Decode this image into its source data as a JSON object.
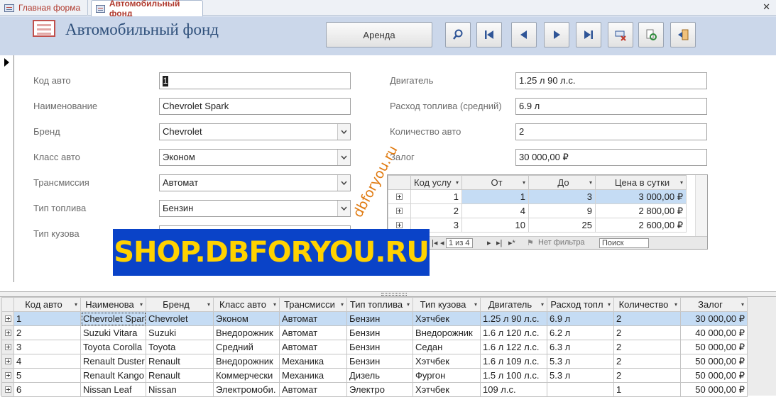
{
  "tabs": [
    {
      "label": "Главная форма"
    },
    {
      "label": "Автомобильный фонд"
    }
  ],
  "header": {
    "title": "Автомобильный фонд",
    "rent_label": "Аренда"
  },
  "form": {
    "left": [
      {
        "label": "Код авто",
        "value": "1"
      },
      {
        "label": "Наименование",
        "value": "Chevrolet Spark"
      },
      {
        "label": "Бренд",
        "value": "Chevrolet"
      },
      {
        "label": "Класс авто",
        "value": "Эконом"
      },
      {
        "label": "Трансмиссия",
        "value": "Автомат"
      },
      {
        "label": "Тип топлива",
        "value": "Бензин"
      },
      {
        "label": "Тип кузова",
        "value": ""
      }
    ],
    "right": [
      {
        "label": "Двигатель",
        "value": "1.25 л 90 л.с."
      },
      {
        "label": "Расход топлива (средний)",
        "value": "6.9 л"
      },
      {
        "label": "Количество авто",
        "value": "2"
      },
      {
        "label": "Залог",
        "value": "30 000,00 ₽"
      }
    ]
  },
  "subform": {
    "columns": [
      "Код услу",
      "От",
      "До",
      "Цена в сутки"
    ],
    "rows": [
      [
        "1",
        "1",
        "3",
        "3 000,00 ₽"
      ],
      [
        "2",
        "4",
        "9",
        "2 800,00 ₽"
      ],
      [
        "3",
        "10",
        "25",
        "2 600,00 ₽"
      ]
    ],
    "nav": {
      "record": "1 из 4",
      "filter": "Нет фильтра",
      "search": "Поиск"
    }
  },
  "watermark": {
    "banner": "SHOP.DBFORYOU.RU",
    "diagonal": "dbforyou.ru"
  },
  "grid": {
    "columns": [
      "Код авто",
      "Наименова",
      "Бренд",
      "Класс авто",
      "Трансмисси",
      "Тип топлива",
      "Тип кузова",
      "Двигатель",
      "Расход топл",
      "Количество",
      "Залог"
    ],
    "rows": [
      [
        "1",
        "Chevrolet Spar",
        "Chevrolet",
        "Эконом",
        "Автомат",
        "Бензин",
        "Хэтчбек",
        "1.25 л 90 л.с.",
        "6.9 л",
        "2",
        "30 000,00 ₽"
      ],
      [
        "2",
        "Suzuki Vitara",
        "Suzuki",
        "Внедорожник",
        "Автомат",
        "Бензин",
        "Внедорожник",
        "1.6 л 120 л.с.",
        "6.2 л",
        "2",
        "40 000,00 ₽"
      ],
      [
        "3",
        "Toyota Corolla",
        "Toyota",
        "Средний",
        "Автомат",
        "Бензин",
        "Седан",
        "1.6 л 122 л.с.",
        "6.3 л",
        "2",
        "50 000,00 ₽"
      ],
      [
        "4",
        "Renault Duster",
        "Renault",
        "Внедорожник",
        "Механика",
        "Бензин",
        "Хэтчбек",
        "1.6 л 109 л.с.",
        "5.3 л",
        "2",
        "50 000,00 ₽"
      ],
      [
        "5",
        "Renault Kango",
        "Renault",
        "Коммерчески",
        "Механика",
        "Дизель",
        "Фургон",
        "1.5 л 100 л.с.",
        "5.3 л",
        "2",
        "50 000,00 ₽"
      ],
      [
        "6",
        "Nissan Leaf",
        "Nissan",
        "Электромоби.",
        "Автомат",
        "Электро",
        "Хэтчбек",
        "109 л.с.",
        "",
        "1",
        "50 000,00 ₽"
      ]
    ]
  }
}
